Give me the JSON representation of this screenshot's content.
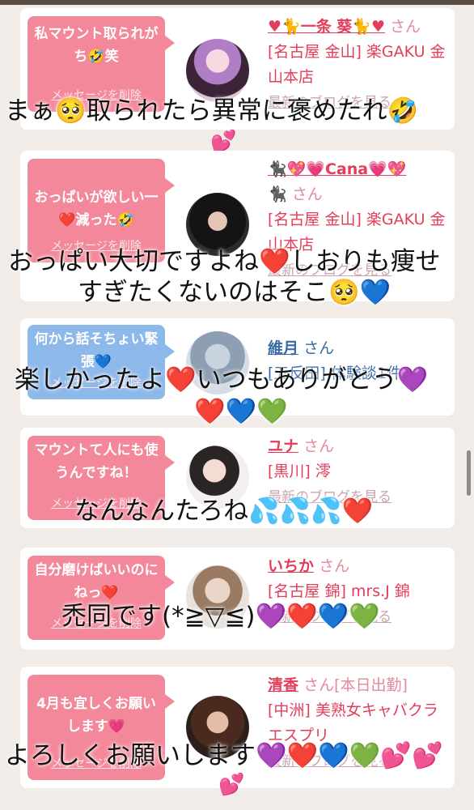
{
  "cards": [
    {
      "bubble": "私マウント取られがち🤣笑",
      "bubble_delete": "メッセージを削除",
      "name": "♥🐈一条 葵🐈♥",
      "san": "さん",
      "shop": "[名古屋 金山] 楽GAKU 金山本店",
      "blog": "最新のブログを見る",
      "overlay": "まぁ🥺取られたら異常に褒めたれ🤣"
    },
    {
      "bubble": "おっぱいが欲しい一❤️減った🤣",
      "bubble_delete": "メッセージを削除",
      "name": "🐈‍⬛💖💗Cana💗💖",
      "name2": "🐈‍⬛",
      "san": "さん",
      "shop": "[名古屋 金山] 楽GAKU 金山本店",
      "blog": "最新のブログを見る",
      "overlay_line1": "おっぱい大切ですよね❤️しおりも痩せ",
      "overlay_line2": "すぎたくないのはそこ🥺💙"
    },
    {
      "bubble": "何から話そちょい緊張💙",
      "bubble_delete": "メッセージを削除",
      "name": "維月",
      "san": "さん",
      "shop": "[五反田] 体験談1件",
      "overlay_line1": "楽しかったよ❤️いつもありがとう💜",
      "overlay_line2": "❤️💙💚"
    },
    {
      "bubble": "マウントて人にも使うんですね！",
      "bubble_delete": "メッセージを削除",
      "name": "ユナ",
      "san": "さん",
      "shop": "[黒川] 澪",
      "blog": "最新のブログを見る",
      "overlay": "なんなんたろね💦💦💦❤️"
    },
    {
      "bubble": "自分磨けばいいのにねっ❤️",
      "bubble_delete": "メッセージを削除",
      "name": "いちか",
      "san": "さん",
      "shop": "[名古屋 錦] mrs.J 錦",
      "blog": "最新のブログを見る",
      "overlay": "禿同です(*≧▽≦)💜❤️💙💚"
    },
    {
      "bubble": "4月も宜しくお願いします💗",
      "bubble_delete": "メッセージを削除",
      "name": "清香",
      "san": "さん[本日出勤]",
      "shop": "[中洲] 美熟女キャバクラ エスプリ",
      "blog": "最新のブログを見る",
      "overlay": "よろしくお願いします💜❤️💙💚💕💕"
    }
  ],
  "stickers": [
    "💕",
    "💕"
  ],
  "colors": {
    "bubble_pink": "#f3889a",
    "bubble_blue": "#8cb8ea",
    "name_red": "#e33d5b",
    "background": "#f1ece7"
  }
}
